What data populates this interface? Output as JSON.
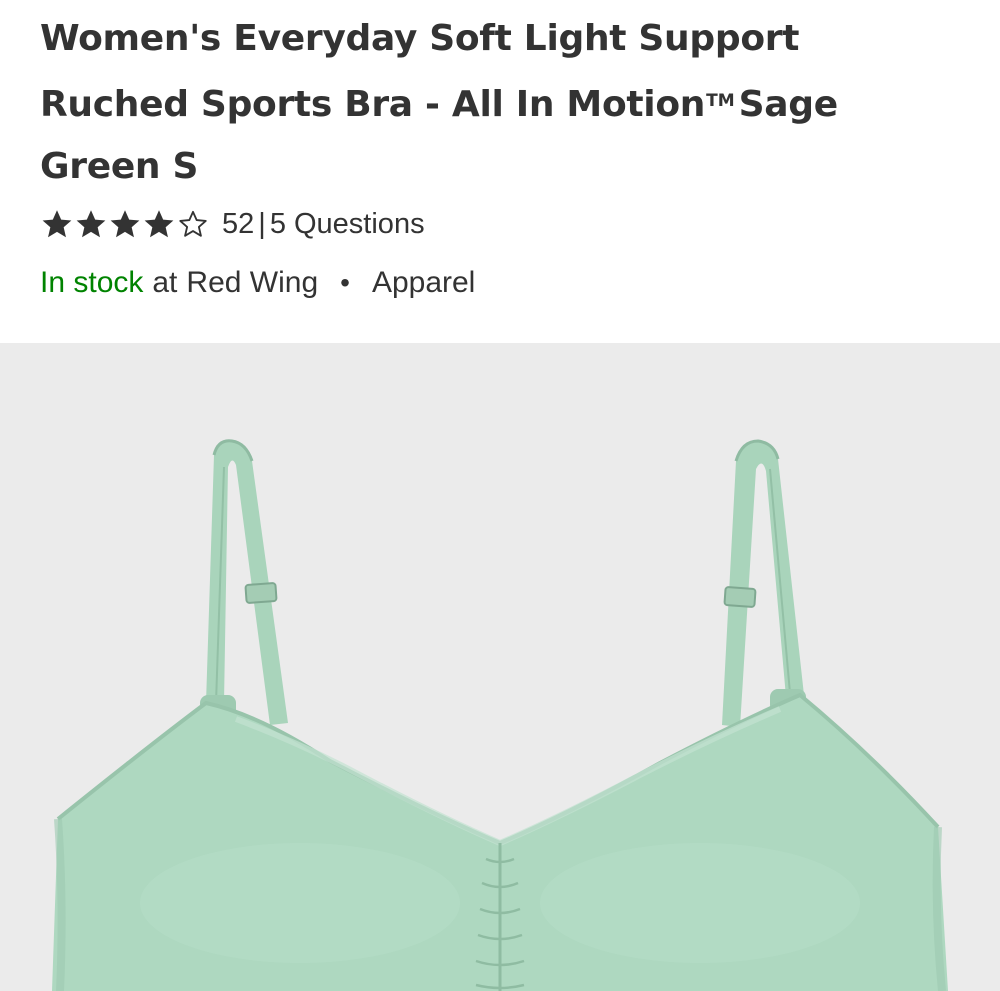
{
  "product": {
    "title_line1": "Women's Everyday Soft Light Support",
    "title_line2_pre": "Ruched Sports Bra - All In Motion",
    "trademark": "TM",
    "title_line2_post": "Sage",
    "title_line3": "Green S"
  },
  "rating": {
    "stars_filled": 4,
    "stars_total": 5,
    "review_count": "52",
    "separator": "|",
    "questions_label": "5 Questions"
  },
  "availability": {
    "status": "In stock",
    "preposition": "at",
    "store": "Red Wing",
    "bullet": "•",
    "category": "Apparel"
  },
  "image": {
    "icon": "product-photo-sports-bra",
    "background_color": "#ebebeb",
    "garment_color": "#aed8c0"
  },
  "colors": {
    "in_stock_green": "#008300",
    "text_primary": "#333333"
  }
}
